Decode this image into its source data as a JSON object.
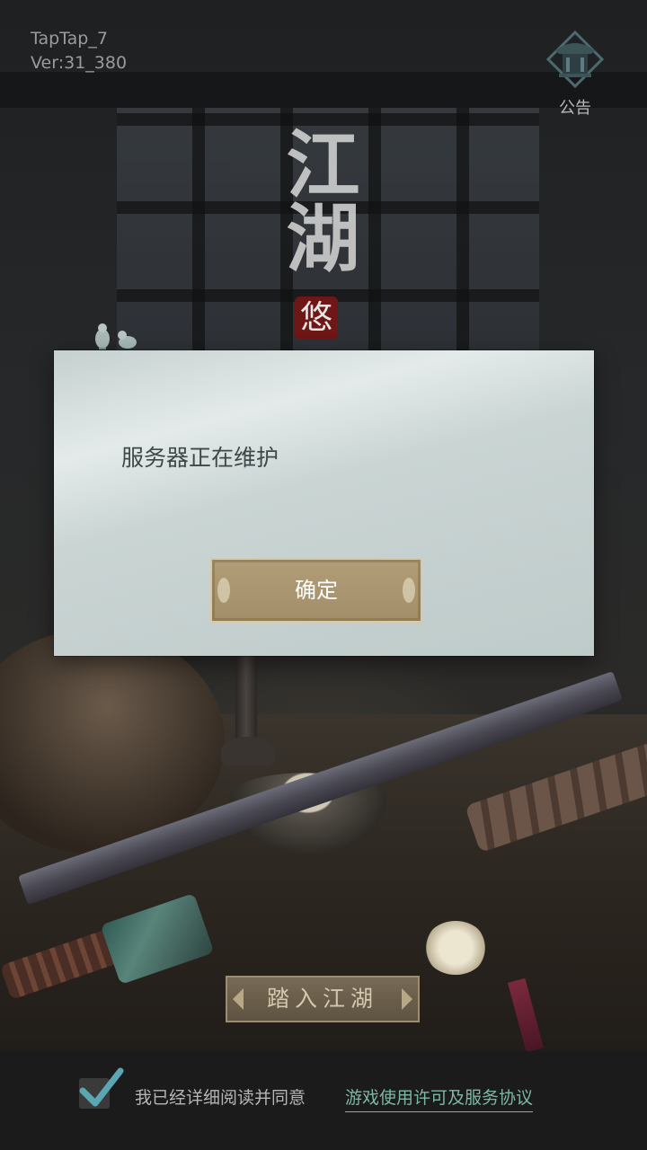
{
  "version": {
    "channel": "TapTap_7",
    "version": "Ver:31_380"
  },
  "notice": {
    "label": "公告",
    "icon": "pavilion-icon"
  },
  "logo": {
    "title": "江湖",
    "seal": "悠"
  },
  "dialog": {
    "message": "服务器正在维护",
    "confirm_label": "确定"
  },
  "enter_button": {
    "label": "踏入江湖"
  },
  "agreement": {
    "checked": true,
    "text": "我已经详细阅读并同意",
    "link": "游戏使用许可及服务协议"
  },
  "colors": {
    "dialog_bg": "#c9d4d3",
    "button_gold": "#a8946e",
    "link_green": "#7bb7a4",
    "checkmark_teal": "#5aa7b3"
  }
}
